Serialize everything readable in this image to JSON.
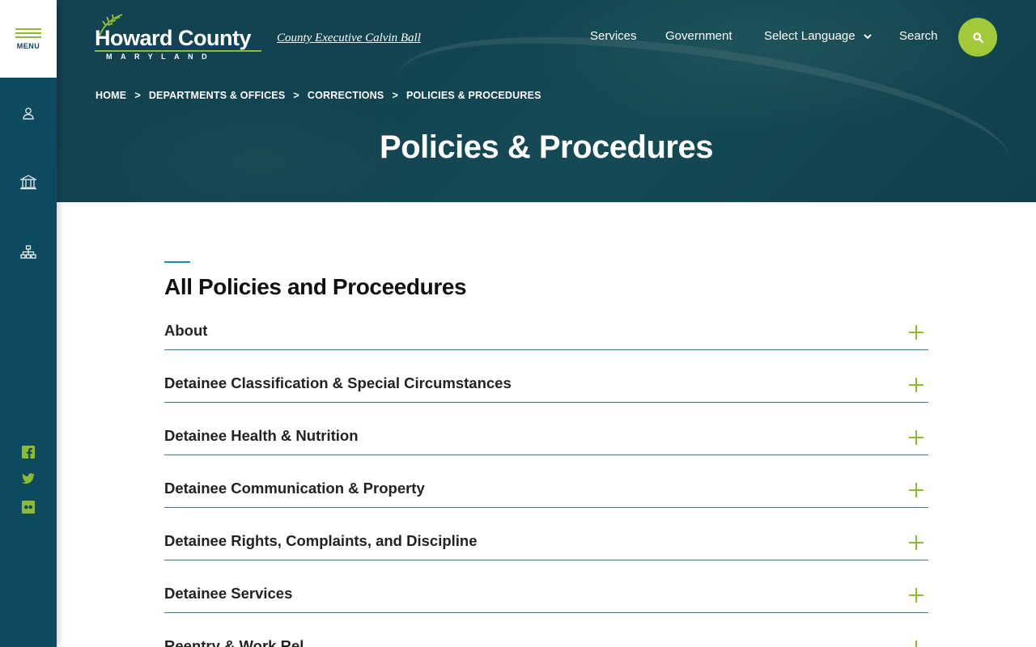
{
  "rail": {
    "menu_label": "MENU",
    "icons": [
      "user-icon",
      "government-building-icon",
      "sitemap-icon"
    ],
    "social": [
      "facebook-icon",
      "twitter-icon",
      "flickr-icon"
    ],
    "color": "#0e4a5f",
    "accent": "#8dba2e"
  },
  "header": {
    "logo_title": "Howard County",
    "logo_sub": "MARYLAND",
    "exec_link": "County Executive Calvin Ball",
    "nav": {
      "services": "Services",
      "government": "Government",
      "language": "Select Language",
      "search": "Search"
    },
    "search_button_color": "#a2c93a"
  },
  "breadcrumb": {
    "items": [
      "HOME",
      "DEPARTMENTS & OFFICES",
      "CORRECTIONS",
      "POLICIES & PROCEDURES"
    ],
    "separator": ">"
  },
  "page_title": "Policies & Procedures",
  "main": {
    "heading": "All Policies and Proceedures",
    "accordion": [
      {
        "label": "About"
      },
      {
        "label": "Detainee Classification & Special Circumstances"
      },
      {
        "label": "Detainee Health & Nutrition"
      },
      {
        "label": "Detainee Communication & Property"
      },
      {
        "label": "Detainee Rights, Complaints, and Discipline"
      },
      {
        "label": "Detainee Services"
      },
      {
        "label": "Reentry & Work Rel..."
      }
    ]
  }
}
